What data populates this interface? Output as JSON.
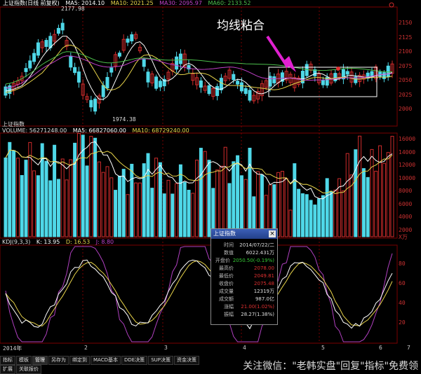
{
  "toolbar": {
    "title": "上证指数(日线 前复权)",
    "ma5": "MA5: 2014.10",
    "ma10": "MA10: 2021.25",
    "ma30": "MA30: 2095.97",
    "ma60": "MA60: 2133.52"
  },
  "price_panel": {
    "high_label": "2177.98",
    "low_label": "1974.38",
    "bottom_left_label": "上证指数",
    "y_ticks": [
      "2150",
      "2125",
      "2100",
      "2075",
      "2050",
      "2025",
      "2000"
    ],
    "annotation": "均线粘合"
  },
  "volume_panel": {
    "legend_vol": "VOLUME: 56271248.00",
    "legend_ma5": "MA5: 66827060.00",
    "legend_ma10": "MA10: 68729240.00",
    "y_ticks": [
      "16000",
      "14000",
      "12000",
      "10000",
      "8000",
      "6000",
      "4000",
      "2000"
    ],
    "unit": "X万"
  },
  "kdj_panel": {
    "legend_name": "KDJ(9,3,3)",
    "legend_k": "K: 13.95",
    "legend_d": "D: 16.53",
    "legend_j": "J: 8.80",
    "y_ticks": [
      "80",
      "60",
      "40",
      "20"
    ]
  },
  "popup": {
    "title": "上证指数",
    "close": "×",
    "rows": [
      {
        "k": "时间",
        "v": "2014/07/22/二",
        "color": "#dddddd"
      },
      {
        "k": "数值",
        "v": "6022.431万",
        "color": "#dddddd"
      },
      {
        "k": "开盘价",
        "v": "2050.50(-0.19%)",
        "color": "#35c835"
      },
      {
        "k": "最高价",
        "v": "2078.00",
        "color": "#e03030"
      },
      {
        "k": "最低价",
        "v": "2049.81",
        "color": "#e03030"
      },
      {
        "k": "收盘价",
        "v": "2075.48",
        "color": "#e03030"
      },
      {
        "k": "成交量",
        "v": "12319万",
        "color": "#dddddd"
      },
      {
        "k": "成交额",
        "v": "987.0亿",
        "color": "#dddddd"
      },
      {
        "k": "涨幅",
        "v": "21.00(1.02%)",
        "color": "#e03030"
      },
      {
        "k": "振幅",
        "v": "28.27(1.38%)",
        "color": "#dddddd"
      }
    ]
  },
  "time_axis": {
    "labels": [
      "2014年",
      "2",
      "3",
      "4",
      "5",
      "6",
      "7"
    ]
  },
  "tabs": [
    {
      "label": "指标",
      "active": false
    },
    {
      "label": "模板",
      "active": false
    },
    {
      "label": "管理",
      "active": true
    },
    {
      "label": "另存为",
      "active": false
    },
    {
      "label": "绑定到",
      "active": false
    },
    {
      "label": "MACD基本",
      "active": false
    },
    {
      "label": "DDE决策",
      "active": false
    },
    {
      "label": "SUP决策",
      "active": false
    },
    {
      "label": "资金决策",
      "active": false
    }
  ],
  "tabs_row2": [
    {
      "label": "扩展"
    },
    {
      "label": "关联报价"
    }
  ],
  "watermark": "关注微信：\"老韩实盘\"回复\"指标\"免费领",
  "colors": {
    "up": "#d02c2c",
    "down": "#4fd8e8",
    "ma5": "#ffffff",
    "ma10": "#e8d44a",
    "ma30": "#c040c8",
    "ma60": "#4cbf4c",
    "k": "#ffffff",
    "d": "#e8d44a",
    "j": "#b040c0"
  }
}
